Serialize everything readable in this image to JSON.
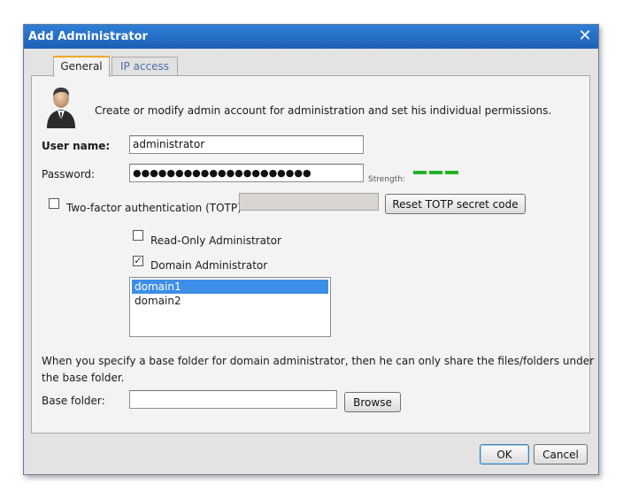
{
  "dialog": {
    "title": "Add Administrator",
    "close_glyph": "✕"
  },
  "tabs": [
    {
      "label": "General",
      "active": true
    },
    {
      "label": "IP access",
      "active": false
    }
  ],
  "intro_text": "Create or modify admin account for administration and set his individual permissions.",
  "icon": "admin-user-icon",
  "username": {
    "label": "User name:",
    "value": "administrator"
  },
  "password": {
    "label": "Password:",
    "masked_value": "●●●●●●●●●●●●●●●●●●●●●"
  },
  "strength": {
    "label": "Strength:",
    "color": "#22b422"
  },
  "totp": {
    "label": "Two-factor authentication (TOTP)",
    "checked": false,
    "code_value": "",
    "reset_button": "Reset TOTP secret code"
  },
  "readonly_admin": {
    "label": "Read-Only Administrator",
    "checked": false
  },
  "domain_admin": {
    "label": "Domain Administrator",
    "checked": true,
    "check_glyph": "✓"
  },
  "domains": [
    {
      "name": "domain1",
      "selected": true
    },
    {
      "name": "domain2",
      "selected": false
    }
  ],
  "base_folder_note": {
    "line1": "When you specify a base folder for domain administrator, then he can only share the files/folders under",
    "line2": "the base folder."
  },
  "base_folder": {
    "label": "Base folder:",
    "value": "",
    "browse_button": "Browse"
  },
  "footer": {
    "ok_button": "OK",
    "cancel_button": "Cancel"
  },
  "colors": {
    "titlebar": "#1d5fb5",
    "selection": "#3d8ee6",
    "tab_accent": "#f0a82a"
  }
}
